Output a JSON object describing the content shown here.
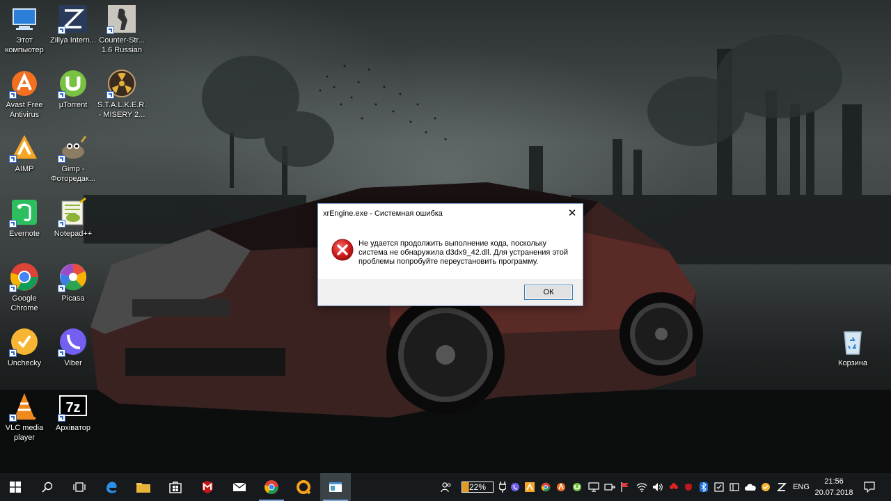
{
  "desktop": {
    "icons": [
      {
        "label": "Этот компьютер",
        "icon": "this-pc-icon"
      },
      {
        "label": "Zillya Intern...",
        "icon": "zillya-icon"
      },
      {
        "label": "Counter-Str... 1.6 Russian",
        "icon": "counter-strike-icon"
      },
      {
        "label": "Avast Free Antivirus",
        "icon": "avast-icon"
      },
      {
        "label": "µTorrent",
        "icon": "utorrent-icon"
      },
      {
        "label": "S.T.A.L.K.E.R. - MISERY 2...",
        "icon": "stalker-icon"
      },
      {
        "label": "AIMP",
        "icon": "aimp-icon"
      },
      {
        "label": "Gimp - Фоторедак...",
        "icon": "gimp-icon"
      },
      {
        "label": "Evernote",
        "icon": "evernote-icon"
      },
      {
        "label": "Notepad++",
        "icon": "notepadpp-icon"
      },
      {
        "label": "Google Chrome",
        "icon": "chrome-icon"
      },
      {
        "label": "Picasa",
        "icon": "picasa-icon"
      },
      {
        "label": "Unchecky",
        "icon": "unchecky-icon"
      },
      {
        "label": "Viber",
        "icon": "viber-icon"
      },
      {
        "label": "VLC media player",
        "icon": "vlc-icon"
      },
      {
        "label": "Архіватор",
        "icon": "7zip-icon"
      },
      {
        "label": "Корзина",
        "icon": "recycle-bin-icon"
      }
    ]
  },
  "dialog": {
    "title": "xrEngine.exe - Системная ошибка",
    "close": "✕",
    "message": "Не удается продолжить выполнение кода, поскольку система не обнаружила d3dx9_42.dll. Для устранения этой проблемы попробуйте переустановить программу.",
    "ok_label": "ОК",
    "icon": "error-icon"
  },
  "taskbar": {
    "battery_percent": "22%",
    "battery_level": 0.22,
    "language": "ENG",
    "time": "21:56",
    "date": "20.07.2018"
  },
  "colors": {
    "taskbar_bg": "#161a1d",
    "accent": "#7aa8d8",
    "error_red": "#d21d1d",
    "dialog_footer": "#f0f0f0"
  }
}
